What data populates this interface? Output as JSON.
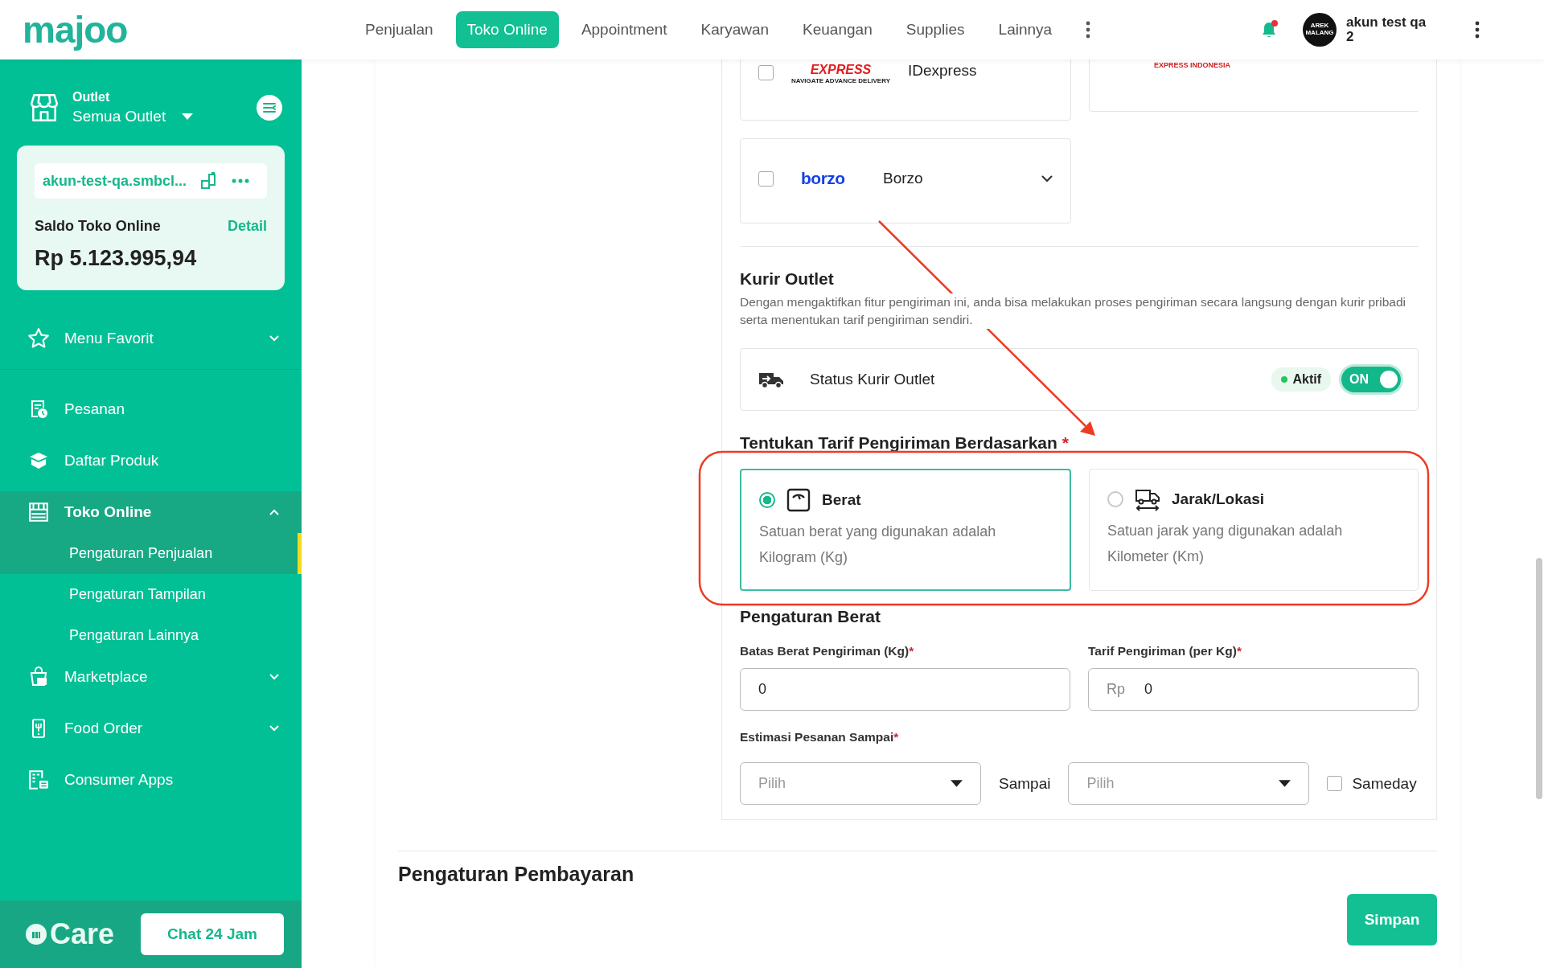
{
  "header": {
    "logo": "majoo",
    "nav": [
      {
        "label": "Penjualan",
        "selected": false
      },
      {
        "label": "Toko Online",
        "selected": true
      },
      {
        "label": "Appointment",
        "selected": false
      },
      {
        "label": "Karyawan",
        "selected": false
      },
      {
        "label": "Keuangan",
        "selected": false
      },
      {
        "label": "Supplies",
        "selected": false
      },
      {
        "label": "Lainnya",
        "selected": false
      }
    ],
    "notification": {
      "unread": true
    },
    "user": {
      "avatar_lines": [
        "AREK",
        "MALANG"
      ],
      "name_lines": [
        "akun test qa",
        "2"
      ]
    }
  },
  "sidebar": {
    "outlet": {
      "label": "Outlet",
      "value": "Semua Outlet"
    },
    "store": {
      "url": "akun-test-qa.smbcl...",
      "balance_label": "Saldo Toko Online",
      "detail_link": "Detail",
      "balance": "Rp 5.123.995,94"
    },
    "favorites": {
      "label": "Menu Favorit",
      "expanded": false
    },
    "menu": [
      {
        "label": "Pesanan",
        "kind": "link",
        "selected": false
      },
      {
        "label": "Daftar Produk",
        "kind": "link",
        "selected": false
      },
      {
        "label": "Toko Online",
        "kind": "group",
        "expanded": true,
        "selected": true,
        "children": [
          {
            "label": "Pengaturan Penjualan",
            "selected": true
          },
          {
            "label": "Pengaturan Tampilan",
            "selected": false
          },
          {
            "label": "Pengaturan Lainnya",
            "selected": false
          }
        ]
      },
      {
        "label": "Marketplace",
        "kind": "group",
        "expanded": false,
        "selected": false
      },
      {
        "label": "Food Order",
        "kind": "group",
        "expanded": false,
        "selected": false
      },
      {
        "label": "Consumer Apps",
        "kind": "link",
        "selected": false
      }
    ],
    "care": {
      "logo": "Care",
      "chat_button": "Chat 24 Jam"
    }
  },
  "couriers": [
    {
      "kind": "idexpress",
      "name": "IDexpress",
      "logo_text": "EXPRESS",
      "logo_subtext": "NAVIGATE ADVANCE DELIVERY",
      "checked": false
    },
    {
      "kind": "jde",
      "logo_text": "EXPRESS INDONESIA"
    },
    {
      "kind": "borzo",
      "name": "Borzo",
      "logo_text": "borzo",
      "checked": false,
      "expanded": false
    }
  ],
  "kurir_outlet": {
    "title": "Kurir Outlet",
    "description": "Dengan mengaktifkan fitur pengiriman ini, anda bisa melakukan proses pengiriman secara langsung dengan kurir pribadi serta menentukan tarif pengiriman sendiri.",
    "status": {
      "label": "Status Kurir Outlet",
      "badge": "Aktif",
      "toggle_text": "ON",
      "on": true
    }
  },
  "tariff": {
    "title": "Tentukan Tarif Pengiriman Berdasarkan",
    "required_mark": "*",
    "options": [
      {
        "title": "Berat",
        "description": "Satuan berat yang digunakan adalah Kilogram (Kg)",
        "selected": true
      },
      {
        "title": "Jarak/Lokasi",
        "description": "Satuan jarak yang digunakan adalah Kilometer (Km)",
        "selected": false
      }
    ]
  },
  "weight": {
    "title": "Pengaturan Berat",
    "fields": [
      {
        "label": "Batas Berat Pengiriman (Kg)",
        "required_mark": "*",
        "value": "0"
      },
      {
        "label": "Tarif Pengiriman (per Kg)",
        "required_mark": "*",
        "prefix": "Rp",
        "value": "0"
      }
    ],
    "estimate": {
      "label": "Estimasi Pesanan Sampai",
      "required_mark": "*",
      "from_placeholder": "Pilih",
      "separator": "Sampai",
      "to_placeholder": "Pilih",
      "sameday": {
        "label": "Sameday",
        "checked": false
      }
    }
  },
  "next_section": "Pengaturan Pembayaran",
  "save_button": "Simpan"
}
